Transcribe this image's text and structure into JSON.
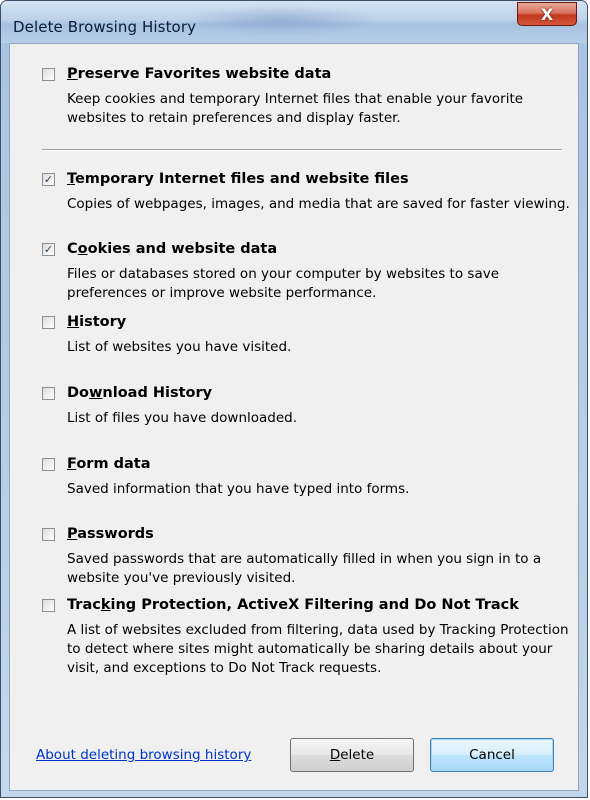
{
  "window": {
    "title": "Delete Browsing History",
    "close_label": "X"
  },
  "options": [
    {
      "title_pre": "",
      "title_accel": "P",
      "title_post": "reserve Favorites website data",
      "description": "Keep cookies and temporary Internet files that enable your favorite websites to retain preferences and display faster.",
      "checked": false
    },
    {
      "title_pre": "",
      "title_accel": "T",
      "title_post": "emporary Internet files and website files",
      "description": "Copies of webpages, images, and media that are saved for faster viewing.",
      "checked": true
    },
    {
      "title_pre": "C",
      "title_accel": "o",
      "title_post": "okies and website data",
      "description": "Files or databases stored on your computer by websites to save preferences or improve website performance.",
      "checked": true
    },
    {
      "title_pre": "",
      "title_accel": "H",
      "title_post": "istory",
      "description": "List of websites you have visited.",
      "checked": false
    },
    {
      "title_pre": "Do",
      "title_accel": "w",
      "title_post": "nload History",
      "description": "List of files you have downloaded.",
      "checked": false
    },
    {
      "title_pre": "",
      "title_accel": "F",
      "title_post": "orm data",
      "description": "Saved information that you have typed into forms.",
      "checked": false
    },
    {
      "title_pre": "",
      "title_accel": "P",
      "title_post": "asswords",
      "description": "Saved passwords that are automatically filled in when you sign in to a website you've previously visited.",
      "checked": false
    },
    {
      "title_pre": "Trac",
      "title_accel": "k",
      "title_post": "ing Protection, ActiveX Filtering and Do Not Track",
      "description": "A list of websites excluded from filtering, data used by Tracking Protection to detect where sites might automatically be sharing details about your visit, and exceptions to Do Not Track requests.",
      "checked": false
    }
  ],
  "footer": {
    "help_link": "About deleting browsing history",
    "delete_accel": "D",
    "delete_rest": "elete",
    "cancel_label": "Cancel"
  },
  "colors": {
    "link": "#0033cc",
    "close_button": "#c2391e",
    "client_background": "#f0f0f0"
  }
}
